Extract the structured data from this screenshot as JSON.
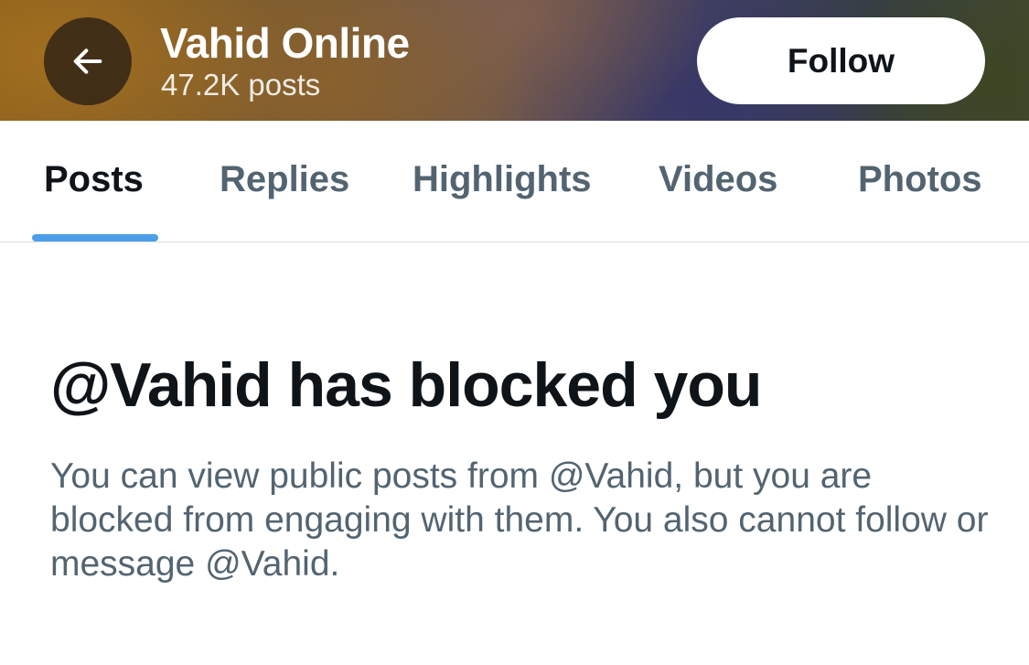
{
  "header": {
    "back_icon": "arrow-left-icon",
    "account_name": "Vahid Online",
    "post_count": "47.2K posts",
    "follow_label": "Follow"
  },
  "tabs": [
    {
      "label": "Posts",
      "active": true
    },
    {
      "label": "Replies",
      "active": false
    },
    {
      "label": "Highlights",
      "active": false
    },
    {
      "label": "Videos",
      "active": false
    },
    {
      "label": "Photos",
      "active": false
    }
  ],
  "blocked": {
    "title": "@Vahid has blocked you",
    "message": "You can view public posts from @Vahid, but you are blocked from engaging with them. You also cannot follow or message @Vahid."
  },
  "colors": {
    "primary_text": "#0f1419",
    "secondary_text": "#536471",
    "tab_indicator": "#4c9ee9",
    "divider": "#d9dde0"
  }
}
